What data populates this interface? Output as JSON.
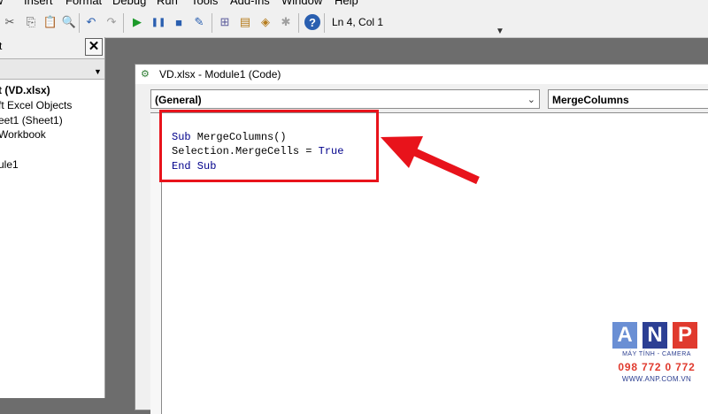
{
  "menubar": {
    "items": [
      "Insert",
      "Format",
      "Debug",
      "Run",
      "Tools",
      "Add-Ins",
      "Window",
      "Help"
    ]
  },
  "toolbar": {
    "icons": [
      "excel-icon",
      "insert-userform-icon",
      "cut-icon",
      "copy-icon",
      "paste-icon",
      "find-icon",
      "undo-icon",
      "redo-icon",
      "run-icon",
      "break-icon",
      "reset-icon",
      "design-mode-icon",
      "project-explorer-icon",
      "properties-icon",
      "object-browser-icon",
      "toolbox-icon",
      "help-icon"
    ],
    "status": "Ln 4, Col 1"
  },
  "project_panel": {
    "title": "t",
    "close_glyph": "✕",
    "tree": [
      {
        "text": "t (VD.xlsx)",
        "bold": true
      },
      {
        "text": "ft Excel Objects",
        "bold": false
      },
      {
        "text": "eet1 (Sheet1)",
        "bold": false
      },
      {
        "text": "Workbook",
        "bold": false
      },
      {
        "text": "",
        "bold": false
      },
      {
        "text": "ule1",
        "bold": false
      }
    ]
  },
  "code_window": {
    "title": "VD.xlsx - Module1 (Code)",
    "object_combo": "(General)",
    "procedure_combo": "MergeColumns",
    "code_lines": [
      [
        {
          "t": "Sub",
          "kw": true
        },
        {
          "t": " MergeColumns()",
          "kw": false
        }
      ],
      [
        {
          "t": "Selection.MergeCells = ",
          "kw": false
        },
        {
          "t": "True",
          "kw": true
        }
      ],
      [
        {
          "t": "End Sub",
          "kw": true
        }
      ]
    ]
  },
  "annotation": {
    "highlight_color": "#e8131b",
    "arrow_color": "#e8131b"
  },
  "logo": {
    "letters": [
      "A",
      "N",
      "P"
    ],
    "colors": [
      "#6a8fd4",
      "#2c3f94",
      "#e03a2e"
    ],
    "tagline": "MÁY TÍNH - CAMERA",
    "phone": "098 772 0 772",
    "url": "WWW.ANP.COM.VN"
  }
}
